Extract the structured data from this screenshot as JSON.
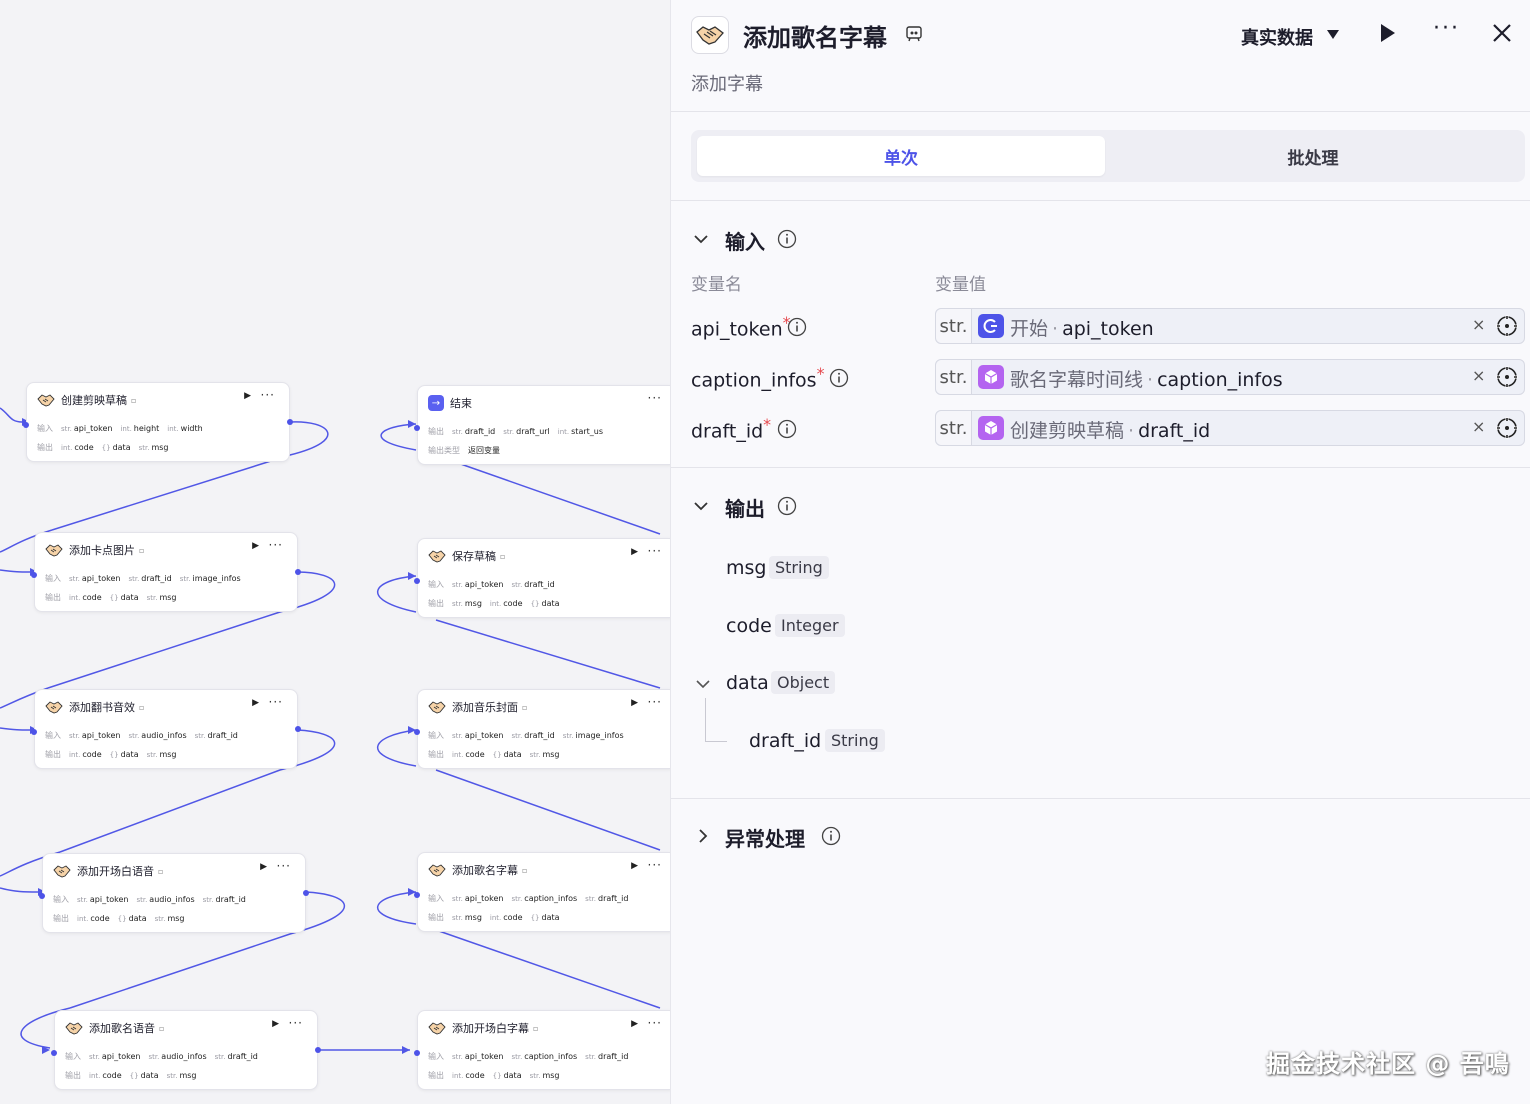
{
  "canvas": {
    "nodes": [
      {
        "title": "创建剪映草稿",
        "inputs": [
          [
            "str.",
            "api_token"
          ],
          [
            "int.",
            "height"
          ],
          [
            "int.",
            "width"
          ]
        ],
        "outputs": [
          [
            "int.",
            "code"
          ],
          [
            "{}",
            "data"
          ],
          [
            "str.",
            "msg"
          ]
        ]
      },
      {
        "title": "添加卡点图片",
        "inputs": [
          [
            "str.",
            "api_token"
          ],
          [
            "str.",
            "draft_id"
          ],
          [
            "str.",
            "image_infos"
          ]
        ],
        "outputs": [
          [
            "int.",
            "code"
          ],
          [
            "{}",
            "data"
          ],
          [
            "str.",
            "msg"
          ]
        ]
      },
      {
        "title": "添加翻书音效",
        "inputs": [
          [
            "str.",
            "api_token"
          ],
          [
            "str.",
            "audio_infos"
          ],
          [
            "str.",
            "draft_id"
          ]
        ],
        "outputs": [
          [
            "int.",
            "code"
          ],
          [
            "{}",
            "data"
          ],
          [
            "str.",
            "msg"
          ]
        ]
      },
      {
        "title": "添加开场白语音",
        "inputs": [
          [
            "str.",
            "api_token"
          ],
          [
            "str.",
            "audio_infos"
          ],
          [
            "str.",
            "draft_id"
          ]
        ],
        "outputs": [
          [
            "int.",
            "code"
          ],
          [
            "{}",
            "data"
          ],
          [
            "str.",
            "msg"
          ]
        ]
      },
      {
        "title": "添加歌名语音",
        "inputs": [
          [
            "str.",
            "api_token"
          ],
          [
            "str.",
            "audio_infos"
          ],
          [
            "str.",
            "draft_id"
          ]
        ],
        "outputs": [
          [
            "int.",
            "code"
          ],
          [
            "{}",
            "data"
          ],
          [
            "str.",
            "msg"
          ]
        ]
      },
      {
        "title": "结束",
        "row1_label": "输出",
        "inputs": [
          [
            "str.",
            "draft_id"
          ],
          [
            "str.",
            "draft_url"
          ],
          [
            "int.",
            "start_us"
          ]
        ],
        "row2_label": "输出类型",
        "row2_value": "返回变量"
      },
      {
        "title": "保存草稿",
        "inputs": [
          [
            "str.",
            "api_token"
          ],
          [
            "str.",
            "draft_id"
          ]
        ],
        "outputs": [
          [
            "str.",
            "msg"
          ],
          [
            "int.",
            "code"
          ],
          [
            "{}",
            "data"
          ]
        ]
      },
      {
        "title": "添加音乐封面",
        "inputs": [
          [
            "str.",
            "api_token"
          ],
          [
            "str.",
            "draft_id"
          ],
          [
            "str.",
            "image_infos"
          ]
        ],
        "outputs": [
          [
            "int.",
            "code"
          ],
          [
            "{}",
            "data"
          ],
          [
            "str.",
            "msg"
          ]
        ]
      },
      {
        "title": "添加歌名字幕",
        "inputs": [
          [
            "str.",
            "api_token"
          ],
          [
            "str.",
            "caption_infos"
          ],
          [
            "str.",
            "draft_id"
          ]
        ],
        "outputs": [
          [
            "str.",
            "msg"
          ],
          [
            "int.",
            "code"
          ],
          [
            "{}",
            "data"
          ]
        ]
      },
      {
        "title": "添加开场白字幕",
        "inputs": [
          [
            "str.",
            "api_token"
          ],
          [
            "str.",
            "caption_infos"
          ],
          [
            "str.",
            "draft_id"
          ]
        ],
        "outputs": [
          [
            "int.",
            "code"
          ],
          [
            "{}",
            "data"
          ],
          [
            "str.",
            "msg"
          ]
        ]
      }
    ],
    "input_label": "输入",
    "output_label": "输出"
  },
  "panel": {
    "title": "添加歌名字幕",
    "subtitle": "添加字幕",
    "mode": "真实数据",
    "more": "···",
    "tabs": [
      "单次",
      "批处理"
    ],
    "input_section": "输入",
    "col_name": "变量名",
    "col_value": "变量值",
    "inputs": [
      {
        "name": "api_token",
        "type": "str.",
        "source": "开始",
        "field": "api_token",
        "icon": "start-icon"
      },
      {
        "name": "caption_infos",
        "type": "str.",
        "source": "歌名字幕时间线",
        "field": "caption_infos",
        "icon": "cube-icon"
      },
      {
        "name": "draft_id",
        "type": "str.",
        "source": "创建剪映草稿",
        "field": "draft_id",
        "icon": "cube-icon"
      }
    ],
    "required_mark": "*",
    "clear_mark": "×",
    "output_section": "输出",
    "outputs": [
      {
        "name": "msg",
        "type": "String"
      },
      {
        "name": "code",
        "type": "Integer"
      },
      {
        "name": "data",
        "type": "Object"
      },
      {
        "name": "draft_id",
        "type": "String"
      }
    ],
    "error_section": "异常处理"
  },
  "watermark": "掘金技术社区 @ 吾鳴",
  "colors": {
    "accent": "#4d53e8",
    "edge": "#5157e6",
    "required": "#e5484d",
    "plugin_purple": "#b464f0"
  }
}
